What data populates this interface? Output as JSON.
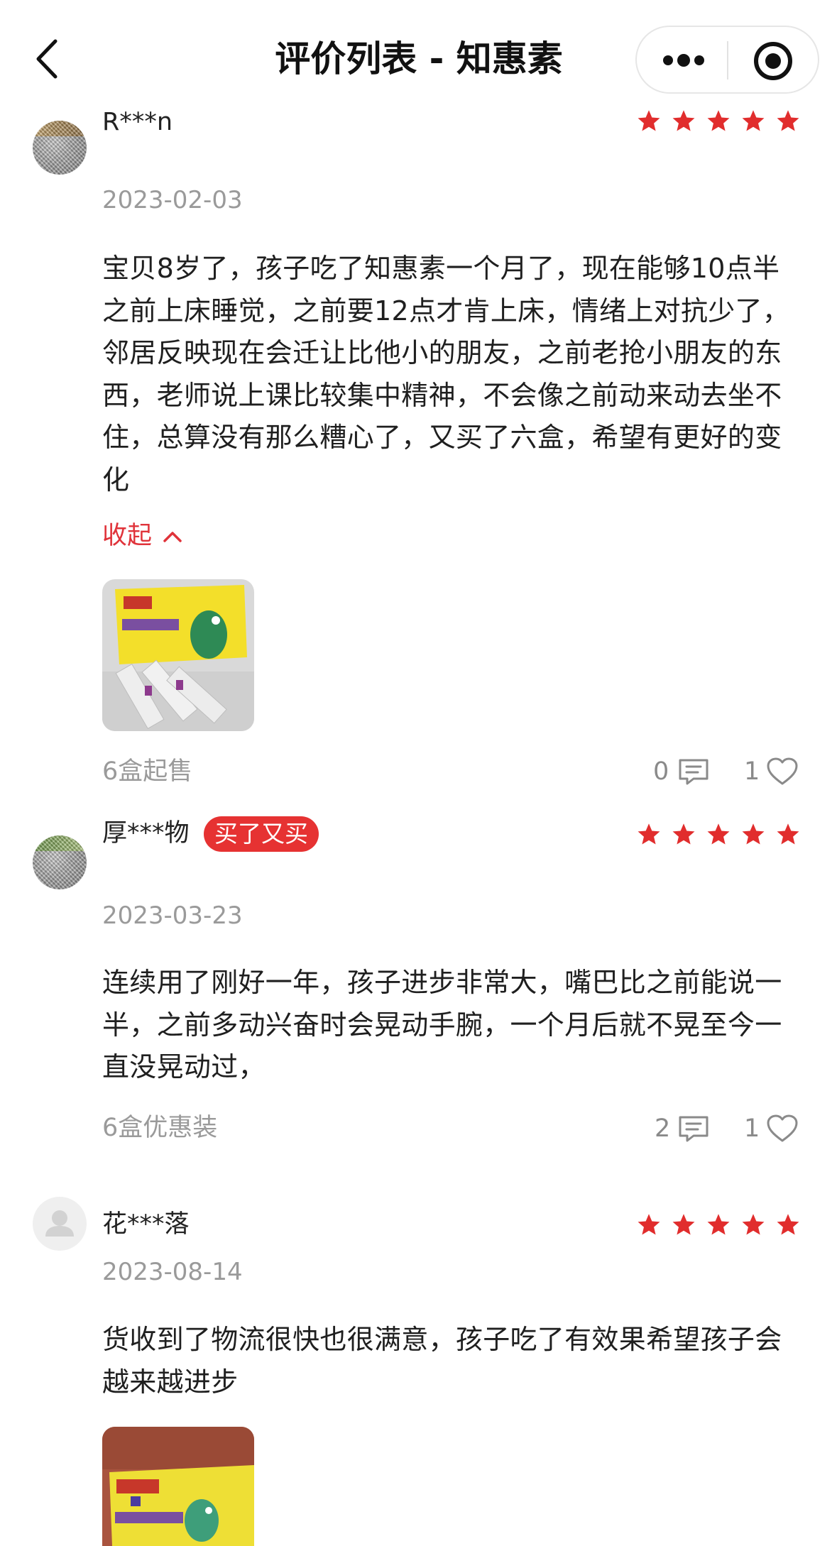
{
  "header": {
    "title": "评价列表 - 知惠素",
    "back_icon": "chevron-left-icon",
    "more_icon": "more-dots-icon",
    "target_icon": "target-icon"
  },
  "colors": {
    "accent": "#e0333a",
    "star": "#e12d2d",
    "muted": "#9a9a9a"
  },
  "reviews": [
    {
      "username": "R***n",
      "rating": 5,
      "date": "2023-02-03",
      "content": "宝贝8岁了，孩子吃了知惠素一个月了，现在能够10点半之前上床睡觉，之前要12点才肯上床，情绪上对抗少了，邻居反映现在会迁让比他小的朋友，之前老抢小朋友的东西，老师说上课比较集中精神，不会像之前动来动去坐不住，总算没有那么糟心了，又买了六盒，希望有更好的变化",
      "collapse_label": "收起",
      "spec": "6盒起售",
      "comments": "0",
      "likes": "1"
    },
    {
      "username": "厚***物",
      "badge": "买了又买",
      "rating": 5,
      "date": "2023-03-23",
      "content": "连续用了刚好一年，孩子进步非常大，嘴巴比之前能说一半，之前多动兴奋时会晃动手腕，一个月后就不晃至今一直没晃动过，",
      "spec": "6盒优惠装",
      "comments": "2",
      "likes": "1"
    },
    {
      "username": "花***落",
      "rating": 5,
      "date": "2023-08-14",
      "content": "货收到了物流很快也很满意，孩子吃了有效果希望孩子会越来越进步"
    }
  ]
}
